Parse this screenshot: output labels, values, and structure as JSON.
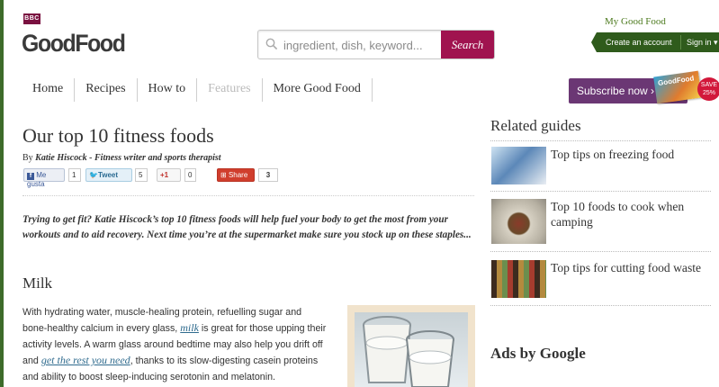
{
  "header": {
    "bbc": "BBC",
    "logo": "GoodFood",
    "search_placeholder": "ingredient, dish, keyword...",
    "search_button": "Search",
    "my_good_food": "My Good Food",
    "create_account": "Create an account",
    "sign_in": "Sign in"
  },
  "nav": {
    "items": [
      "Home",
      "Recipes",
      "How to",
      "Features",
      "More Good Food"
    ],
    "subscribe": "Subscribe now ›",
    "magazine": "GoodFood",
    "save_badge": "SAVE 25%"
  },
  "article": {
    "title": "Our top 10 fitness foods",
    "byline_prefix": "By",
    "byline_author": "Katie Hiscock - Fitness writer and sports therapist",
    "social": {
      "facebook": "Me gusta",
      "facebook_count": "1",
      "tweet": "Tweet",
      "tweet_count": "5",
      "gplus": "+1",
      "gplus_count": "0",
      "share": "Share",
      "share_count": "3"
    },
    "intro": "Trying to get fit? Katie Hiscock’s top 10 fitness foods will help fuel your body to get the most from your workouts and to aid recovery. Next time you’re at the supermarket make sure you stock up on these staples...",
    "section_heading": "Milk",
    "body_part1": "With hydrating water, muscle-healing protein, refuelling sugar and bone-healthy calcium in every glass,",
    "body_link1": "milk",
    "body_part2": "is great for those upping their activity levels. A warm glass around bedtime may also help you drift off and",
    "body_link2": "get the rest you need",
    "body_part3": ", thanks to its slow-digesting casein proteins and ability to boost sleep-inducing serotonin and melatonin."
  },
  "sidebar": {
    "related_title": "Related guides",
    "guides": [
      {
        "title": "Top tips on freezing food",
        "thumb": "freezer-bags"
      },
      {
        "title": "Top 10 foods to cook when camping",
        "thumb": "camping-meal"
      },
      {
        "title": "Top tips for cutting food waste",
        "thumb": "pantry-shelves"
      }
    ],
    "ads_title": "Ads by Google"
  },
  "colors": {
    "brand_plum": "#a0134f",
    "account_green": "#2f5b1c",
    "subscribe_purple": "#6b3774",
    "link_blue": "#2f6b8e"
  }
}
